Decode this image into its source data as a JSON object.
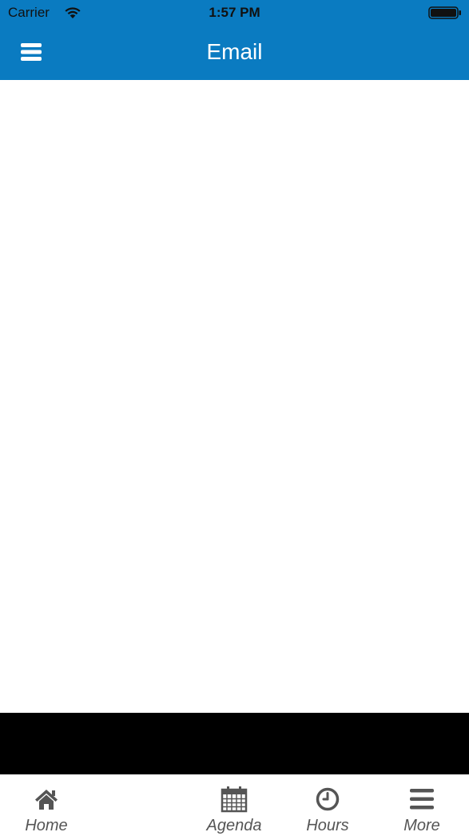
{
  "status_bar": {
    "carrier": "Carrier",
    "time": "1:57 PM",
    "icons": [
      "wifi-icon",
      "battery-icon"
    ]
  },
  "nav_bar": {
    "title": "Email",
    "menu_icon": "hamburger-menu-icon",
    "background_color": "#0a7bc1"
  },
  "tab_bar": {
    "tabs": [
      {
        "label": "Home",
        "icon": "home-icon"
      },
      {
        "label": "Agenda",
        "icon": "calendar-icon"
      },
      {
        "label": "Hours",
        "icon": "clock-icon"
      },
      {
        "label": "More",
        "icon": "more-menu-icon"
      }
    ],
    "tint_color": "#555555"
  }
}
